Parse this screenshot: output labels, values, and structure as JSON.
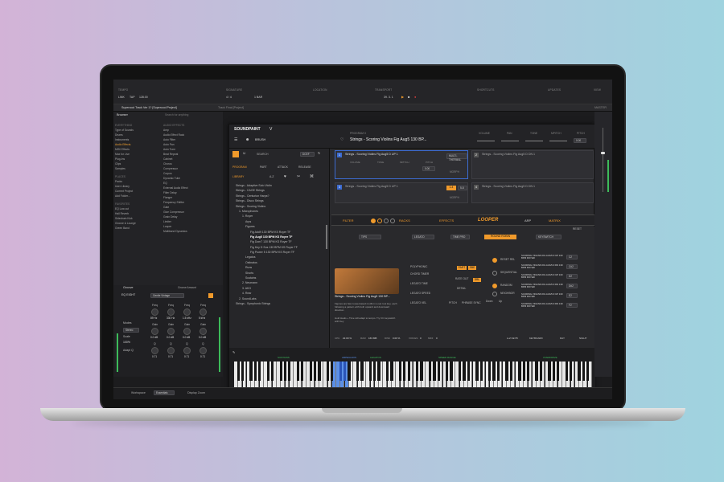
{
  "topbar": {
    "sections": [
      "TEMPO",
      "SIGNATURE",
      "LOCATION",
      "TRANSPORT",
      "SHORTCUTS",
      "UPDATES",
      "VIEW"
    ],
    "link": "LINK",
    "tap": "TAP",
    "tempo": "128.00",
    "sig": "4 / 4",
    "bar": "1 BAR",
    "position": "39. 3. 1"
  },
  "tabs": {
    "tab1": "Supercool Track Ver 1? [Supercool Project]",
    "tab2": "Track Final [Project]",
    "track_label": "MASTER"
  },
  "browser": {
    "title": "Browser",
    "search_placeholder": "Search for anything",
    "col2_header": "AUDIO EFFECTS",
    "everything_label": "EVERYTHING",
    "places_label": "PLACES",
    "favorites_label": "FAVORITES",
    "col1": [
      "Type of Sounds",
      "Drums",
      "Instruments",
      "Audio Effects",
      "MIDI Effects",
      "Max for Live",
      "Plug-Ins",
      "Clips",
      "Samples"
    ],
    "col1_places": [
      "Packs",
      "User Library",
      "Current Project",
      "Add Folder..."
    ],
    "col1_fav": [
      "EQ Low cut",
      "Hall Reverb",
      "Sidechain Kick",
      "Groove & Lounge",
      "Green Band"
    ],
    "col2": [
      "Amp",
      "Audio Effect Rack",
      "Auto Filter",
      "Auto Pan",
      "Auto Tune",
      "Beat Repeat",
      "Cabinet",
      "Chorus",
      "Compressor",
      "Corpus",
      "Dynamic Tube",
      "EQ",
      "External Audio Effect",
      "Filter Delay",
      "Flanger",
      "Frequency Shifter",
      "Gate",
      "Glue Compressor",
      "Grain Delay",
      "Limiter",
      "Looper",
      "Multiband Dynamics"
    ]
  },
  "eq": {
    "title": "Groove",
    "device": "EQ EIGHT",
    "preset": "Gentle Vintage",
    "freq_label": "Freq",
    "gain_label": "Gain",
    "q_label": "Q",
    "freq_values": [
      "89 Hz",
      "330 Hz",
      "1.5 kHz",
      "5 kHz"
    ],
    "gain_values": [
      "0.0 dB",
      "0.0 dB",
      "0.0 dB",
      "0.0 dB"
    ],
    "q_values": [
      "0.71",
      "0.71",
      "0.71",
      "0.71"
    ],
    "mode_label": "Modes",
    "mode_value": "Stereo",
    "scale_label": "Scale",
    "scale_value": "100%",
    "adapt_label": "Adapt Q",
    "green_amount": "Groove Amount"
  },
  "plugin": {
    "brand": "SOUNDPAINT",
    "brand_suffix": "V",
    "brush": "BRUSH",
    "program_label": "PROGRAM X",
    "program_name": "Strings - Scoring Violins Fig Aug5 130 BP...",
    "search_label": "SEARCH",
    "search_btn": "DCEF",
    "nav": [
      "PROGRAM",
      "PART",
      "ATTACK",
      "RELEASE"
    ],
    "nav2": [
      "LIBRARY",
      "",
      "A-Z",
      "",
      ""
    ],
    "volume": "VOLUME",
    "pan": "PAN",
    "tone": "TONE",
    "mpitch": "MPITCH",
    "pitch": "PITCH",
    "pitch_value": "0.00",
    "tree": [
      "Strings - Adaptive Solo Violin",
      "Strings - CAGE Strings",
      "Strings - Centurion Harps?",
      "Strings - Disco Strings",
      "Strings - Scoring Violins",
      "1. Microphones",
      "1. Royer",
      "Arps",
      "Figures",
      "Fig Add9 130 BPM KS Royer TF",
      "Fig Aug5 130 BPM KS Royer TF",
      "Fig Dom7 130 BPM KS Royer TF",
      "Fig Key D Sus 130 BPM KS Royer TF",
      "Fig Power 5 130 BPM KS Royer TF",
      "Legatos",
      "Ostinatos",
      "Runs",
      "Shorts",
      "Sustains",
      "2. Neumann",
      "3. AKG",
      "4. Rear",
      "2. SoundLabs",
      "Strings - Symphonic Strings"
    ],
    "slot1_name": "Strings - Scoring Violins Fig Aug5 D UP 1",
    "slot2_name": "Strings - Scoring Violins Fig Aug5 D DN 1",
    "slot3_name": "Strings - Scoring Violins Fig Aug5 D UP 1",
    "slot4_name": "Strings - Scoring Violins Fig Aug5 D DN 1",
    "multi_thermal": "MULTI-THERMAL",
    "morph": "MORPH",
    "slot_volume": "VOLUME",
    "slot_tone": "TONE",
    "slot_mpitch": "MPITCH",
    "slot_pitch": "PITCH",
    "slot_pitch_val": "0.00",
    "range_btn1": "1-4",
    "range_btn2": "5-8",
    "modules": [
      "FILTER",
      "RACKS",
      "EFFECTS",
      "LOOPER",
      "ARP",
      "MATRIX"
    ],
    "rack_letters": [
      "A",
      "B",
      "C",
      "D"
    ],
    "tips_label": "TIPS",
    "legato_label": "LEGATO",
    "time_pro": "TIME PRO",
    "round_robin": "ROUND ROBIN",
    "keyswitch": "KEYSWITCH",
    "preview_name": "Strings - Scoring Violins Fig Aug5 130 BP...",
    "preview_desc": "Figures are fast, loose-based motifs in a set root key, each following a pattern with both upward and downward direction.",
    "preview_desc2": "Hold Hauls + Time will adapt to tempo. Try CC keyswitch with Key",
    "polyphonic": "POLYPHONIC",
    "chord_timer": "CHORD TIMER",
    "legato_time": "LEGATO TIME",
    "legato_speed": "LEGATO SPEED",
    "legato_vel": "LEGATO VEL",
    "part": "PART",
    "sbe": "SBE",
    "rate_out": "RATE OUT",
    "dbl": "DBL",
    "pitch_label": "PITCH",
    "phrase_sync": "PHRASE SYNC",
    "detail": "DETAIL",
    "reset_rel": "RESET REL",
    "sequential": "SEQUENTIAL",
    "random": "RANDOM",
    "neighbor": "NEIGHBOR",
    "down": "Down",
    "up": "Up",
    "reset": "RESET",
    "matrix_rows": [
      {
        "name": "SCORING VIOLINS FIG AUG5 D UP 130 BPM ROYER",
        "key": "C2"
      },
      {
        "name": "SCORING VIOLINS FIG AUG5 D DN 130 BPM ROYER",
        "key": "C#2"
      },
      {
        "name": "SCORING VIOLINS FIG AUG5 D UP 130 BPM ROYER",
        "key": "D2"
      },
      {
        "name": "SCORING VIOLINS FIG AUG5 D DN 130 BPM ROYER",
        "key": "D#2"
      },
      {
        "name": "SCORING VIOLINS FIG AUG5 D UP 130 BPM ROYER",
        "key": "E2"
      },
      {
        "name": "SCORING VIOLINS FIG AUG5 D DN 130 BPM ROYER",
        "key": "F2"
      }
    ],
    "footer_cpu": "CPU",
    "footer_cpu_val": "22.00 %",
    "footer_ram": "RAM",
    "footer_ram_val": "163 MB",
    "footer_disk": "DISK",
    "footer_disk_val": "0.00 %",
    "footer_voices": "VOICES",
    "footer_voices_val": "0",
    "footer_midi": "MIDI",
    "footer_midi_val": "0",
    "a_z_kb": "A-Z KEYB",
    "keyboard_lbl": "KEYBOARD",
    "day": "DAY",
    "night": "NIGHT",
    "key_zones": [
      "SUSTAINS",
      "ARPEGGIOS",
      "LEGATOS",
      "SPEED RANGE",
      "OVERDRIVE"
    ]
  },
  "status": {
    "workspace_label": "Workspace",
    "workspace_value": "Essentials",
    "display_zoom": "Display Zoom"
  },
  "colors": {
    "accent": "#f09a2b",
    "slot_blue": "#3c6bd0",
    "key_highlight": "#5b8fe6",
    "meter_green": "#3dbb5a"
  }
}
